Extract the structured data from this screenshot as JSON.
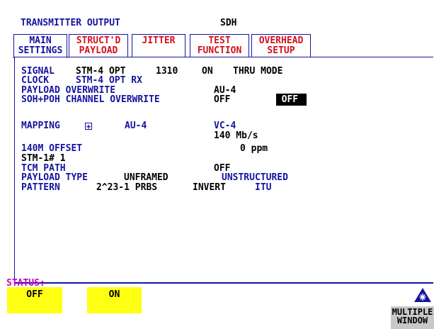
{
  "header": {
    "title": "TRANSMITTER OUTPUT",
    "mode": "SDH"
  },
  "tabs": [
    {
      "line1": "MAIN",
      "line2": "SETTINGS",
      "active": true
    },
    {
      "line1": "STRUCT'D",
      "line2": "PAYLOAD",
      "active": false
    },
    {
      "line1": "JITTER",
      "line2": "",
      "active": false
    },
    {
      "line1": "TEST",
      "line2": "FUNCTION",
      "active": false
    },
    {
      "line1": "OVERHEAD",
      "line2": "SETUP",
      "active": false
    }
  ],
  "settings": {
    "signal": {
      "label": "SIGNAL",
      "value": "STM-4 OPT",
      "wavelength": "1310",
      "state": "ON",
      "mode": "THRU MODE"
    },
    "clock": {
      "label": "CLOCK",
      "value": "STM-4 OPT RX"
    },
    "payload_overwrite": {
      "label": "PAYLOAD OVERWRITE",
      "level": "AU-4",
      "value": "OFF"
    },
    "soh_poh": {
      "label": "SOH+POH CHANNEL OVERWRITE",
      "value": "OFF"
    },
    "mapping": {
      "label": "MAPPING",
      "icon": "plus-box-icon",
      "au": "AU-4",
      "vc": "VC-4",
      "rate": "140 Mb/s"
    },
    "offset": {
      "label": "140M OFFSET",
      "value": "0 ppm"
    },
    "stm1": {
      "label": "STM-1# 1"
    },
    "tcm_path": {
      "label": "TCM PATH",
      "value": "OFF"
    },
    "payload_type": {
      "label": "PAYLOAD TYPE",
      "value": "UNFRAMED",
      "structure": "UNSTRUCTURED"
    },
    "pattern": {
      "label": "PATTERN",
      "value": "2^23-1 PRBS",
      "invert": "INVERT",
      "standard": "ITU"
    }
  },
  "status": {
    "label": "STATUS:",
    "softkeys": [
      "OFF",
      "ON"
    ]
  },
  "multiple_window": {
    "line1": "MULTIPLE",
    "line2": "WINDOW",
    "icon": "asterisk-triangle-icon"
  },
  "colors": {
    "label": "#1414a0",
    "value": "#000000",
    "tab_text": "#d4101e",
    "status": "#d000c8",
    "softkey": "#ffff14"
  }
}
